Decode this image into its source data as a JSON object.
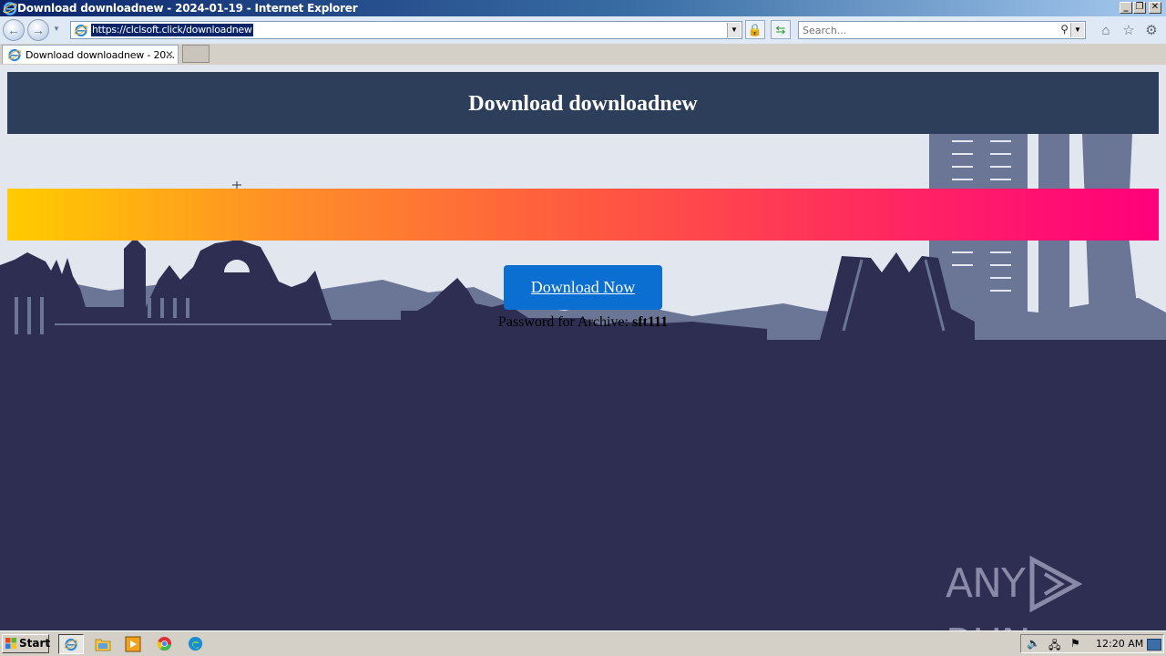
{
  "window": {
    "title": "Download downloadnew - 2024-01-19 - Internet Explorer"
  },
  "toolbar": {
    "address_url": "https://clclsoft.click/downloadnew",
    "search_placeholder": "Search..."
  },
  "tabs": [
    {
      "label": "Download downloadnew - 20...",
      "active": true
    }
  ],
  "page": {
    "heading": "Download downloadnew",
    "download_button_label": "Download Now",
    "password_prefix": "Password for Archive:",
    "password_value": "sft111"
  },
  "watermark": {
    "left": "ANY",
    "right": "RUN"
  },
  "taskbar": {
    "start_label": "Start",
    "clock": "12:20 AM",
    "apps": [
      "internet-explorer",
      "file-explorer",
      "media-player",
      "chrome",
      "edge"
    ]
  },
  "colors": {
    "header_bg": "#2c3e5a",
    "button_bg": "#0a6fd1",
    "page_bg_dark": "#2e2e52",
    "gradient_start": "#ffcc00",
    "gradient_end": "#ff007a"
  }
}
